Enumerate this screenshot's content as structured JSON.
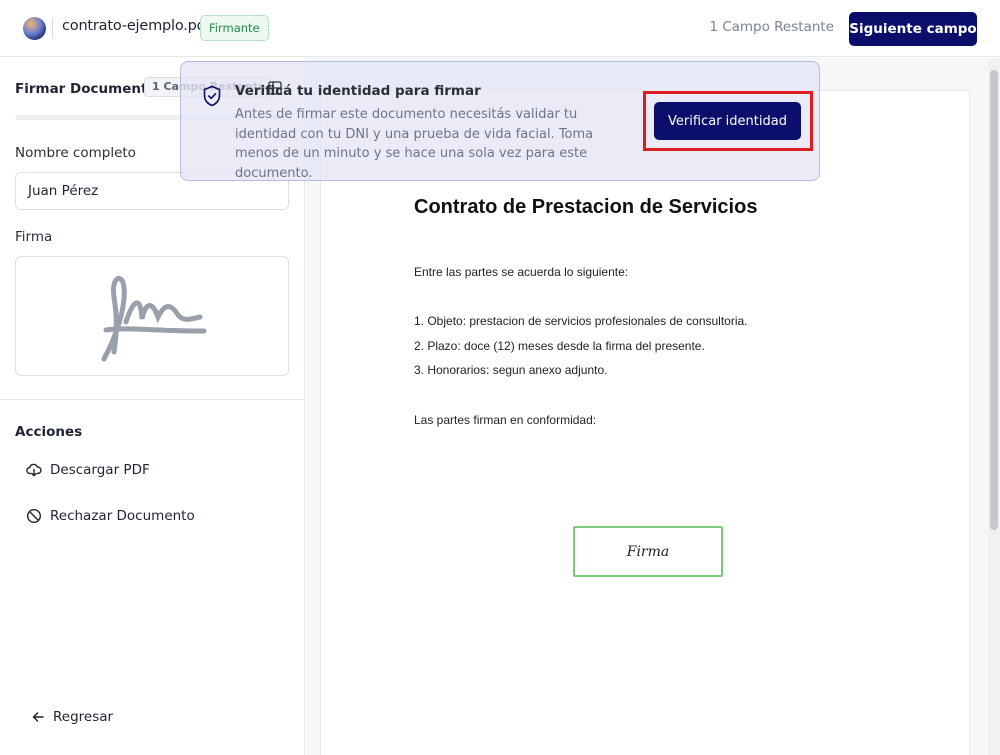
{
  "header": {
    "filename": "contrato-ejemplo.pdf",
    "role_badge": "Firmante",
    "remaining": "1 Campo Restante",
    "next_button": "Siguiente campo"
  },
  "sidebar": {
    "title": "Firmar Documento",
    "badge": "1 Campo Restante",
    "name_label": "Nombre completo",
    "name_value": "Juan Pérez",
    "signature_label": "Firma",
    "actions_title": "Acciones",
    "actions": [
      {
        "label": "Descargar PDF",
        "icon": "cloud-download-icon"
      },
      {
        "label": "Rechazar Documento",
        "icon": "ban-icon"
      }
    ],
    "back_label": "Regresar"
  },
  "verify_banner": {
    "title": "Verificá tu identidad para firmar",
    "text": "Antes de firmar este documento necesitás validar tu identidad con tu DNI y una prueba de vida facial. Toma menos de un minuto y se hace una sola vez para este documento.",
    "button": "Verificar identidad"
  },
  "document": {
    "title": "Contrato de Prestacion de Servicios",
    "intro": "Entre las partes se acuerda lo siguiente:",
    "clauses": [
      "1. Objeto: prestacion de servicios profesionales de consultoria.",
      "2. Plazo: doce (12) meses desde la firma del presente.",
      "3. Honorarios: segun anexo adjunto."
    ],
    "closing": "Las partes firman en conformidad:",
    "signature_field": "Firma"
  },
  "colors": {
    "primary": "#0b0f6b",
    "success": "#1e8b45",
    "highlight": "#d91f1f"
  }
}
